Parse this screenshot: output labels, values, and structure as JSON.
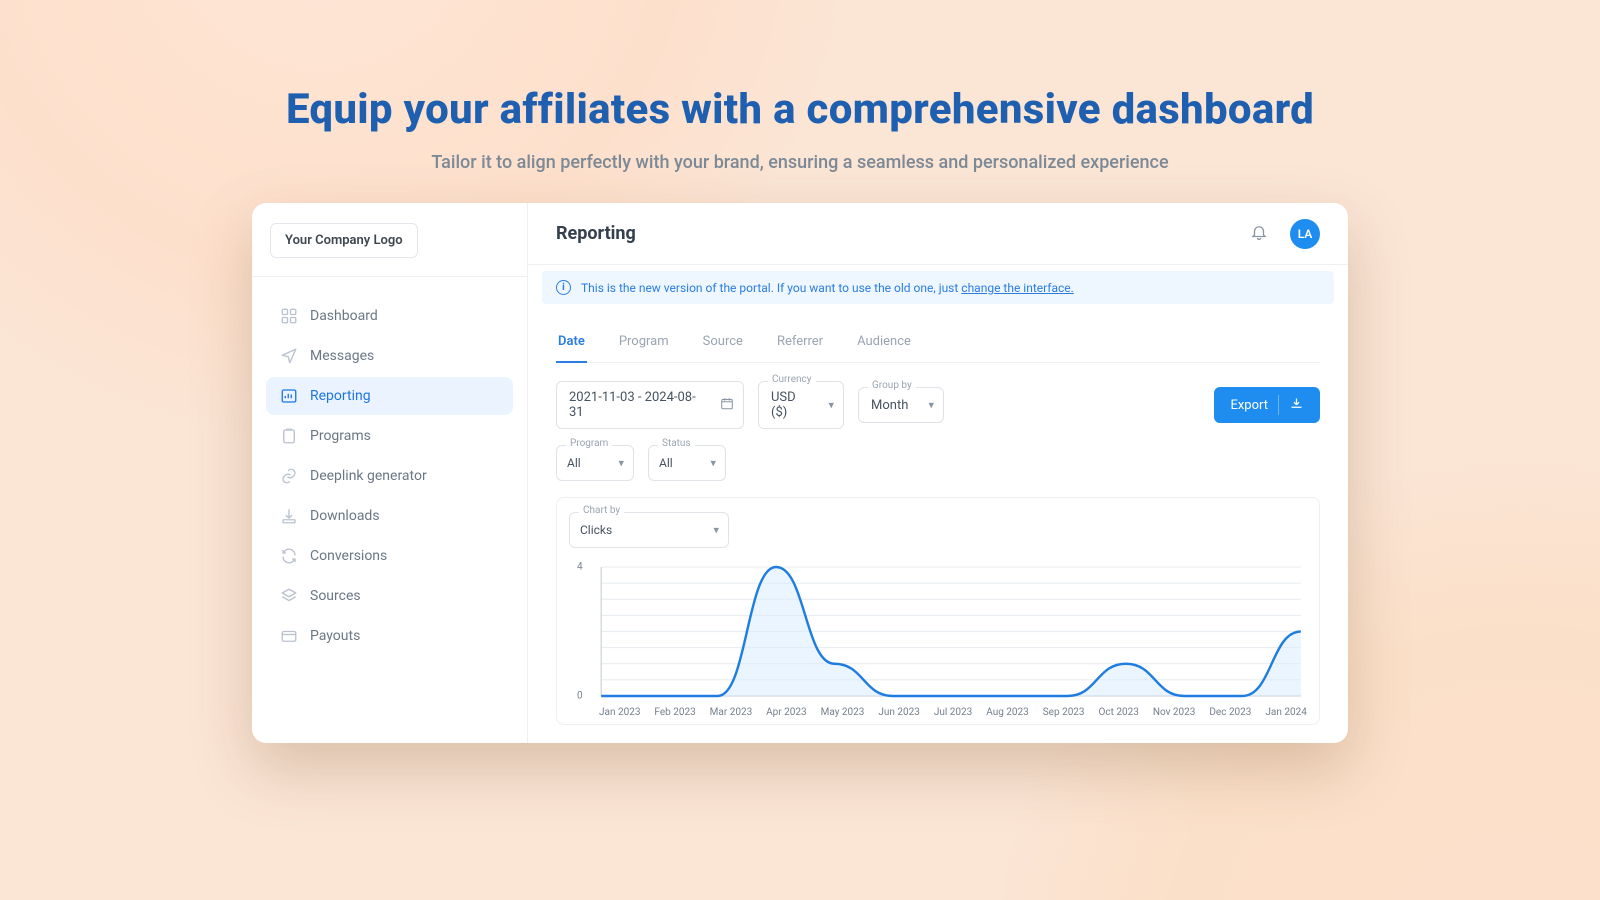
{
  "hero": {
    "title": "Equip your affiliates with  a comprehensive dashboard",
    "subtitle": "Tailor it to align perfectly with your brand, ensuring a seamless and personalized experience"
  },
  "sidebar": {
    "logo": "Your Company Logo",
    "items": [
      {
        "label": "Dashboard"
      },
      {
        "label": "Messages"
      },
      {
        "label": "Reporting"
      },
      {
        "label": "Programs"
      },
      {
        "label": "Deeplink generator"
      },
      {
        "label": "Downloads"
      },
      {
        "label": "Conversions"
      },
      {
        "label": "Sources"
      },
      {
        "label": "Payouts"
      }
    ]
  },
  "header": {
    "title": "Reporting",
    "avatar_initials": "LA"
  },
  "banner": {
    "text": "This is the new version of the portal. If you want to use the old one, just ",
    "link": "change the interface."
  },
  "tabs": [
    {
      "label": "Date",
      "active": true
    },
    {
      "label": "Program"
    },
    {
      "label": "Source"
    },
    {
      "label": "Referrer"
    },
    {
      "label": "Audience"
    }
  ],
  "filters": {
    "date_range": "2021-11-03 - 2024-08-31",
    "currency_label": "Currency",
    "currency_value": "USD ($)",
    "groupby_label": "Group by",
    "groupby_value": "Month",
    "program_label": "Program",
    "program_value": "All",
    "status_label": "Status",
    "status_value": "All",
    "export": "Export",
    "chartby_label": "Chart by",
    "chartby_value": "Clicks"
  },
  "chart_data": {
    "type": "line",
    "title": "",
    "xlabel": "",
    "ylabel": "",
    "categories": [
      "Jan 2023",
      "Feb 2023",
      "Mar 2023",
      "Apr 2023",
      "May 2023",
      "Jun 2023",
      "Jul 2023",
      "Aug 2023",
      "Sep 2023",
      "Oct 2023",
      "Nov 2023",
      "Dec 2023",
      "Jan 2024"
    ],
    "values": [
      0,
      0,
      0,
      4,
      1,
      0,
      0,
      0,
      0,
      1,
      0,
      0,
      2
    ],
    "ylim": [
      0,
      4
    ],
    "yticks": [
      0,
      4
    ],
    "grid": true
  }
}
